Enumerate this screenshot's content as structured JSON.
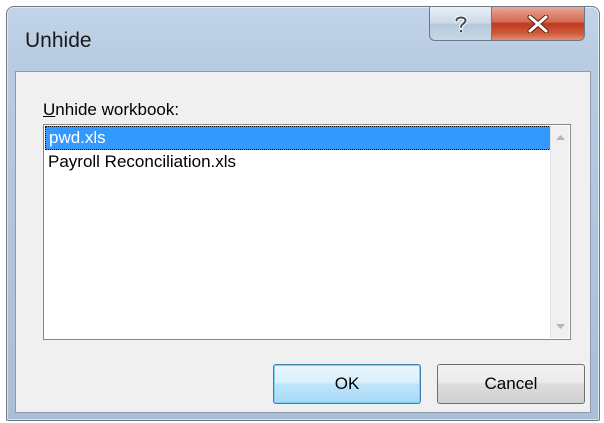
{
  "window": {
    "title": "Unhide",
    "help_icon": "question-mark-icon",
    "close_icon": "close-x-icon"
  },
  "dialog": {
    "label_accesskey": "U",
    "label_rest": "nhide workbook:",
    "items": [
      {
        "label": "pwd.xls",
        "selected": true
      },
      {
        "label": "Payroll Reconciliation.xls",
        "selected": false
      }
    ],
    "scroll_up_icon": "scroll-up-arrow-icon",
    "scroll_down_icon": "scroll-down-arrow-icon"
  },
  "buttons": {
    "ok_label": "OK",
    "cancel_label": "Cancel"
  },
  "colors": {
    "selection": "#3399ff",
    "close_button": "#c0391f",
    "frame": "#b7cbe1"
  }
}
